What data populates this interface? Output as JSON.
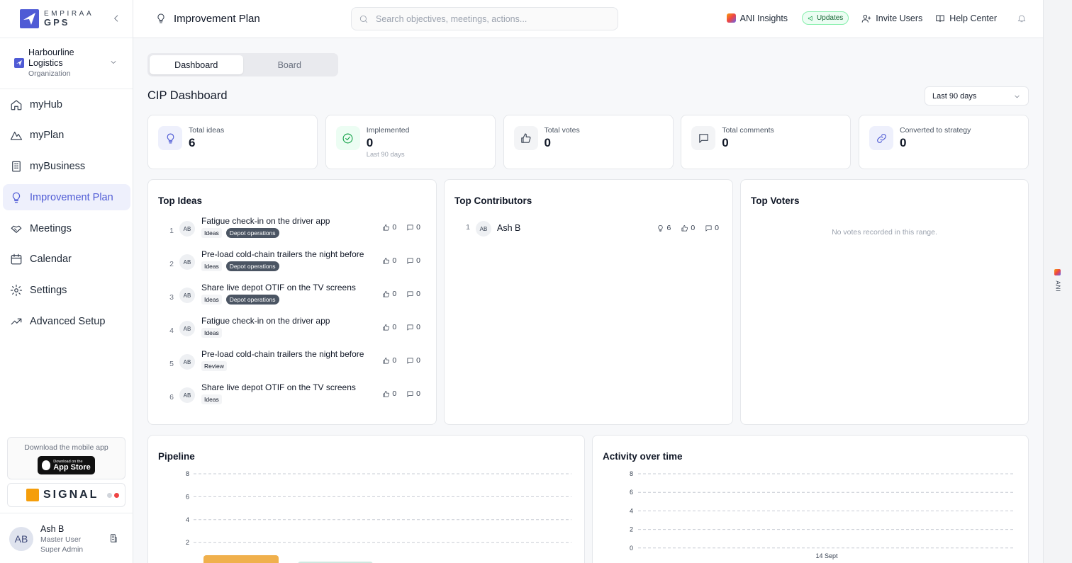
{
  "brand": {
    "line1": "EMPIRAA",
    "line2": "GPS"
  },
  "org": {
    "name": "Harbourline Logistics",
    "type": "Organization"
  },
  "nav": [
    {
      "label": "myHub",
      "icon": "home-icon"
    },
    {
      "label": "myPlan",
      "icon": "mountain-icon"
    },
    {
      "label": "myBusiness",
      "icon": "building-icon"
    },
    {
      "label": "Improvement Plan",
      "icon": "lightbulb-icon",
      "active": true
    },
    {
      "label": "Meetings",
      "icon": "handshake-icon"
    },
    {
      "label": "Calendar",
      "icon": "calendar-icon"
    },
    {
      "label": "Settings",
      "icon": "gear-icon"
    },
    {
      "label": "Advanced Setup",
      "icon": "trending-up-icon"
    }
  ],
  "mobile": {
    "text": "Download the mobile app",
    "store_small": "Download on the",
    "store_big": "App Store"
  },
  "signal": {
    "text": "SIGNAL"
  },
  "user": {
    "name": "Ash B",
    "initials": "AB",
    "role": "Master User",
    "role2": "Super Admin"
  },
  "topbar": {
    "title": "Improvement Plan",
    "search_placeholder": "Search objectives, meetings, actions...",
    "ani": "ANI Insights",
    "updates": "Updates",
    "invite": "Invite Users",
    "help": "Help Center"
  },
  "rail": {
    "label": "ANI"
  },
  "tabs": [
    "Dashboard",
    "Board"
  ],
  "dashboard": {
    "title": "CIP Dashboard",
    "range": "Last 90 days"
  },
  "stats": [
    {
      "label": "Total ideas",
      "value": "6",
      "sub": "",
      "icon": "lightbulb-icon"
    },
    {
      "label": "Implemented",
      "value": "0",
      "sub": "Last 90 days",
      "icon": "check-circle-icon"
    },
    {
      "label": "Total votes",
      "value": "0",
      "sub": "",
      "icon": "thumbs-up-icon"
    },
    {
      "label": "Total comments",
      "value": "0",
      "sub": "",
      "icon": "comment-icon"
    },
    {
      "label": "Converted to strategy",
      "value": "0",
      "sub": "",
      "icon": "link-icon"
    }
  ],
  "top_ideas": {
    "title": "Top Ideas",
    "items": [
      {
        "rank": "1",
        "initials": "AB",
        "title": "Fatigue check-in on the driver app",
        "tags": [
          "Ideas",
          "Depot operations"
        ],
        "votes": "0",
        "comments": "0"
      },
      {
        "rank": "2",
        "initials": "AB",
        "title": "Pre-load cold-chain trailers the night before",
        "tags": [
          "Ideas",
          "Depot operations"
        ],
        "votes": "0",
        "comments": "0"
      },
      {
        "rank": "3",
        "initials": "AB",
        "title": "Share live depot OTIF on the TV screens",
        "tags": [
          "Ideas",
          "Depot operations"
        ],
        "votes": "0",
        "comments": "0"
      },
      {
        "rank": "4",
        "initials": "AB",
        "title": "Fatigue check-in on the driver app",
        "tags": [
          "Ideas"
        ],
        "votes": "0",
        "comments": "0"
      },
      {
        "rank": "5",
        "initials": "AB",
        "title": "Pre-load cold-chain trailers the night before",
        "tags": [
          "Review"
        ],
        "votes": "0",
        "comments": "0"
      },
      {
        "rank": "6",
        "initials": "AB",
        "title": "Share live depot OTIF on the TV screens",
        "tags": [
          "Ideas"
        ],
        "votes": "0",
        "comments": "0"
      }
    ]
  },
  "top_contributors": {
    "title": "Top Contributors",
    "items": [
      {
        "rank": "1",
        "initials": "AB",
        "name": "Ash B",
        "ideas": "6",
        "votes": "0",
        "comments": "0"
      }
    ]
  },
  "top_voters": {
    "title": "Top Voters",
    "empty": "No votes recorded in this range."
  },
  "pipeline": {
    "title": "Pipeline"
  },
  "activity": {
    "title": "Activity over time"
  },
  "chart_data": [
    {
      "type": "bar",
      "title": "Pipeline",
      "yticks": [
        2,
        4,
        6,
        8
      ],
      "ylim": [
        0,
        8
      ],
      "series": [
        {
          "values": [],
          "color": "#f0b04c"
        },
        {
          "values": [],
          "color": "#cfe8e0"
        }
      ]
    },
    {
      "type": "line",
      "title": "Activity over time",
      "yticks": [
        0,
        2,
        4,
        6,
        8
      ],
      "ylim": [
        0,
        8
      ],
      "x": [
        "14 Sept"
      ]
    }
  ]
}
